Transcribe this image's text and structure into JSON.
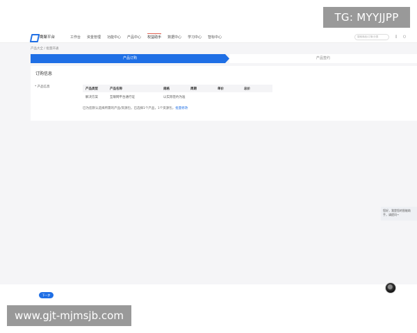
{
  "watermarks": {
    "top": "TG: MYYJJPP",
    "bottom": "www.gjt-mjmsjb.com"
  },
  "header": {
    "logo_text": "鹰聚平台",
    "nav": [
      "工作台",
      "资金管理",
      "功能中心",
      "产品中心",
      "权益助手",
      "数据中心",
      "学习中心",
      "智标中心"
    ],
    "active_nav_index": 4,
    "search_placeholder": "搜索商品/订单/分类",
    "icons": [
      "bell-icon",
      "user-icon"
    ]
  },
  "breadcrumb": "产品大全 / 批量开通",
  "steps": {
    "active": "产品订购",
    "next": "产品签约"
  },
  "order_info": {
    "title": "订购信息",
    "field_label": "* 产品信息",
    "columns": [
      "产品类型",
      "产品名称",
      "规格",
      "周期",
      "单价",
      "总价"
    ],
    "rows": [
      [
        "解决方案",
        "互联网平台通行证",
        "以实际签约为准",
        "",
        "",
        ""
      ]
    ],
    "note_text": "已为您默认选择所需的产品/资源包，已选择1个产品，1个资源包，",
    "note_link": "批量修改"
  },
  "chat": {
    "message": "您好，我是您的智能助手，请提问~"
  },
  "footer": {
    "next_button": "下一步"
  },
  "colors": {
    "accent": "#1f6fe5",
    "background": "#f5f5f7"
  }
}
